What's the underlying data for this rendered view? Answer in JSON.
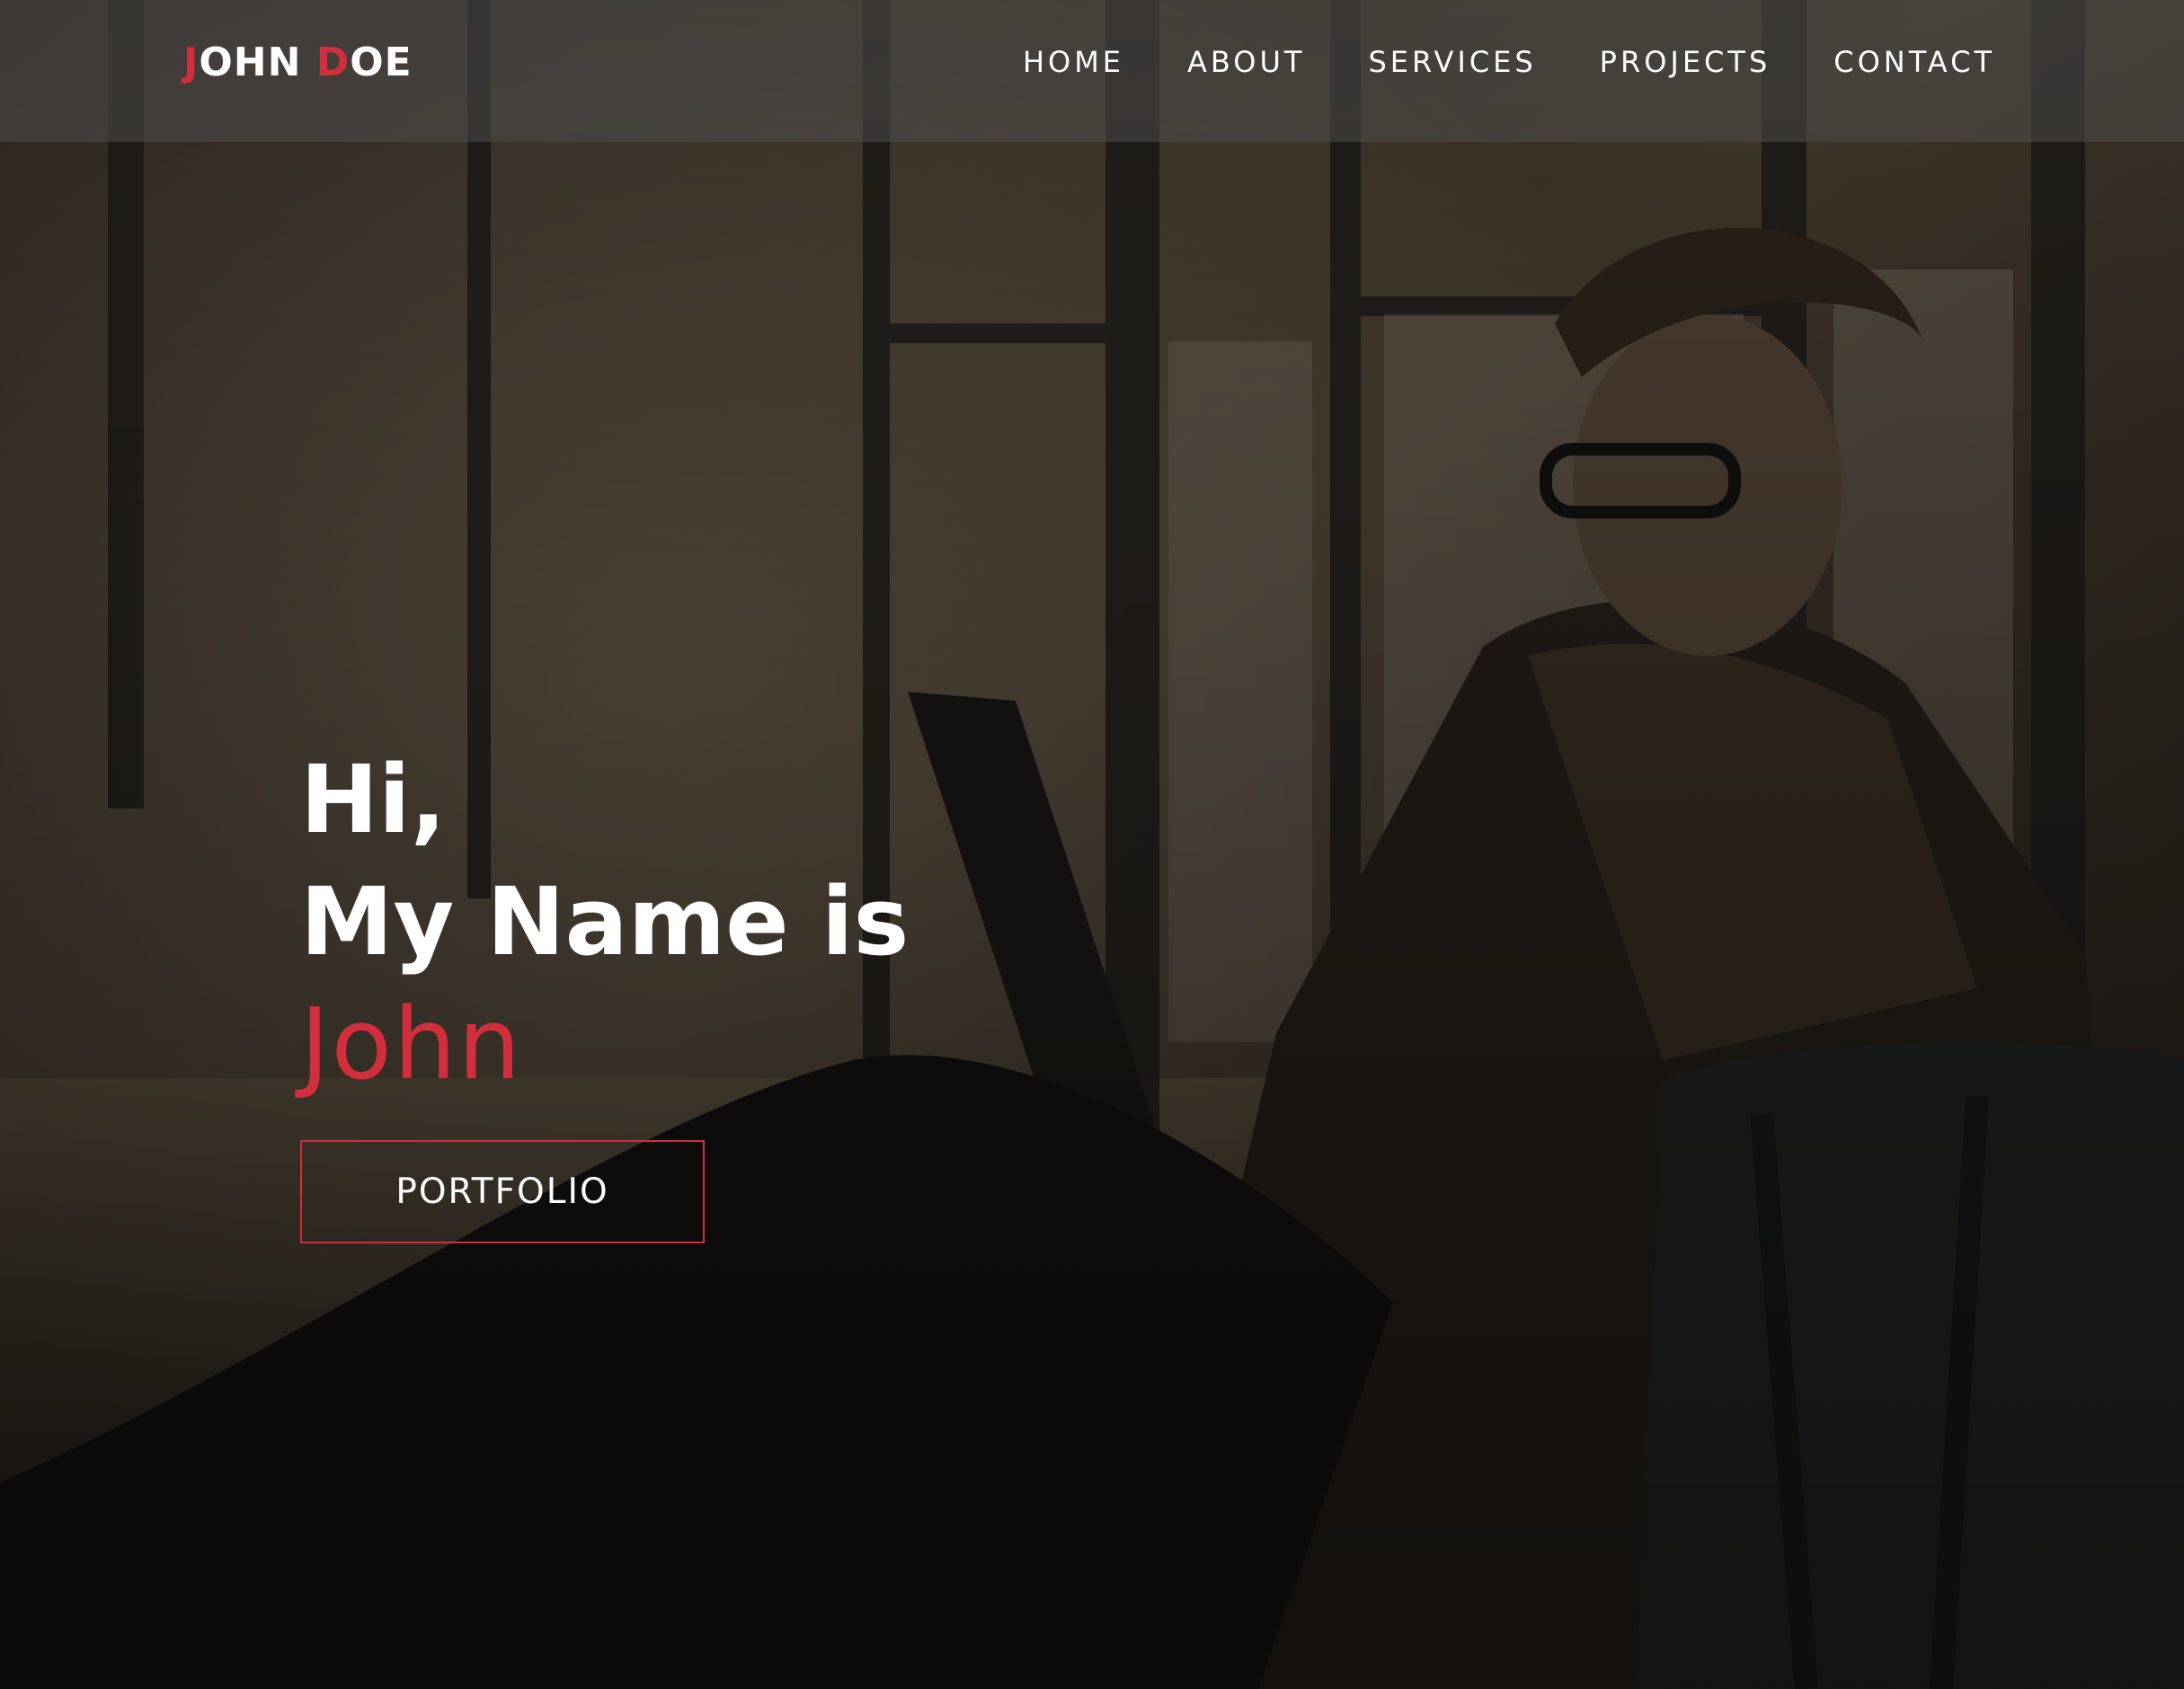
{
  "brand": {
    "logo_first_initial": "J",
    "logo_first_rest": "OHN ",
    "logo_last_initial": "D",
    "logo_last_rest": "OE",
    "accent_color": "#d12e3e"
  },
  "nav": {
    "items": [
      {
        "label": "HOME"
      },
      {
        "label": "ABOUT"
      },
      {
        "label": "SERVICES"
      },
      {
        "label": "PROJECTS"
      },
      {
        "label": "CONTACT"
      }
    ]
  },
  "hero": {
    "greeting": "Hi,",
    "intro": "My Name is",
    "name": "John",
    "cta_label": "PORTFOLIO",
    "background_image": "man-with-laptop-and-phone-photo"
  },
  "colors": {
    "text": "#ffffff",
    "accent": "#d12e3e",
    "navbar_overlay": "rgba(78,76,74,0.55)"
  }
}
